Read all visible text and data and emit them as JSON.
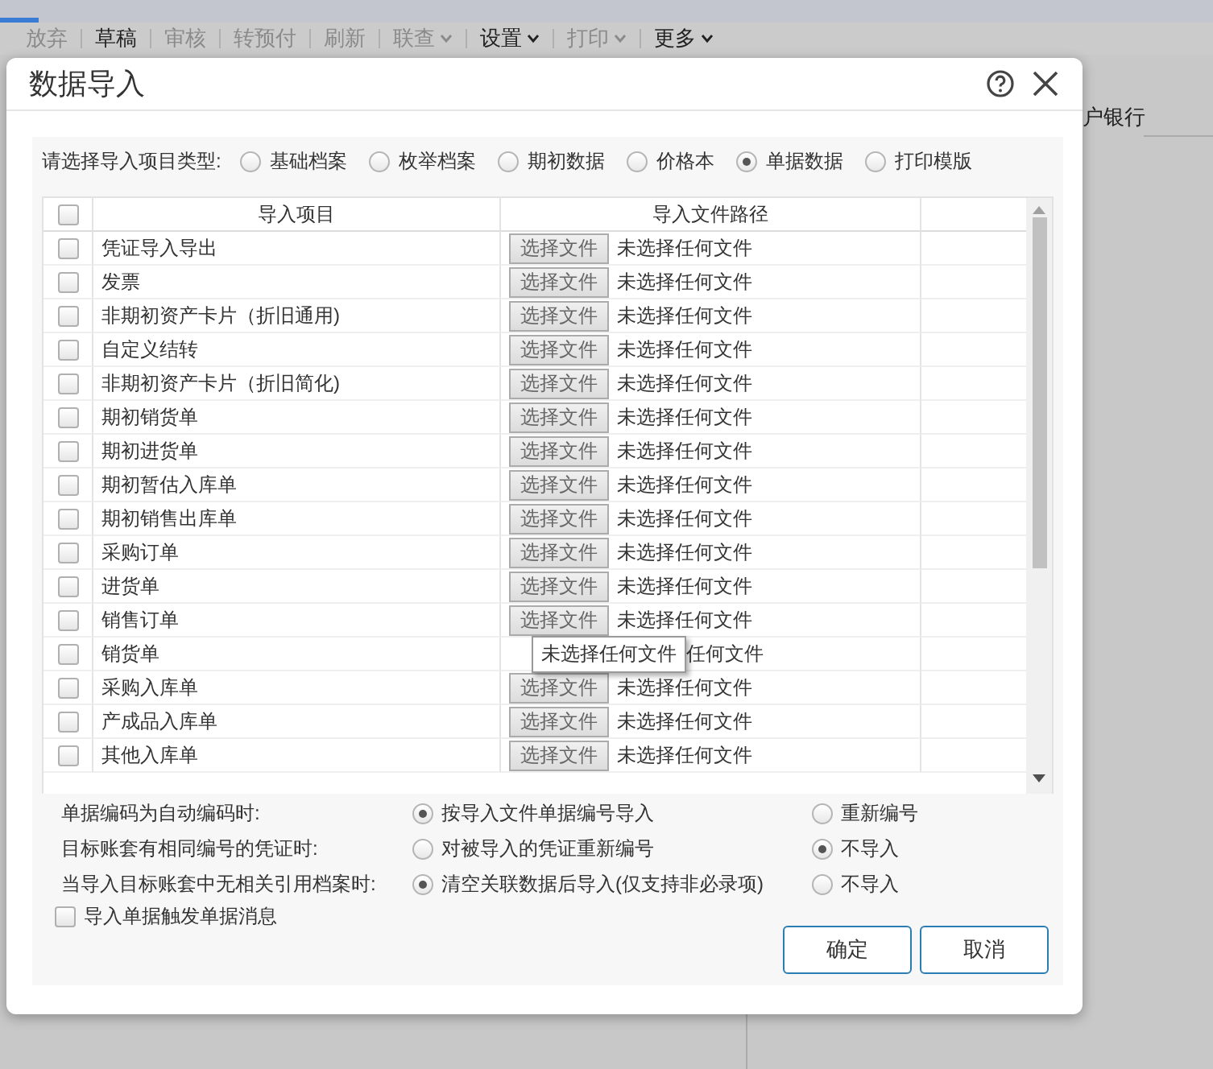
{
  "background": {
    "toolbar": [
      {
        "label": "放弃",
        "caret": false,
        "disabled": true
      },
      {
        "label": "草稿",
        "caret": false,
        "disabled": false
      },
      {
        "label": "审核",
        "caret": false,
        "disabled": true
      },
      {
        "label": "转预付",
        "caret": false,
        "disabled": true
      },
      {
        "label": "刷新",
        "caret": false,
        "disabled": true
      },
      {
        "label": "联查",
        "caret": true,
        "disabled": true
      },
      {
        "label": "设置",
        "caret": true,
        "disabled": false
      },
      {
        "label": "打印",
        "caret": true,
        "disabled": true
      },
      {
        "label": "更多",
        "caret": true,
        "disabled": false
      }
    ],
    "field_label": "户银行"
  },
  "dialog": {
    "title": "数据导入",
    "type_prompt": "请选择导入项目类型:",
    "types": [
      {
        "label": "基础档案",
        "selected": false
      },
      {
        "label": "枚举档案",
        "selected": false
      },
      {
        "label": "期初数据",
        "selected": false
      },
      {
        "label": "价格本",
        "selected": false
      },
      {
        "label": "单据数据",
        "selected": true
      },
      {
        "label": "打印模版",
        "selected": false
      }
    ],
    "table": {
      "columns": [
        "导入项目",
        "导入文件路径"
      ],
      "header_checked": false,
      "rows": [
        {
          "name": "凭证导入导出",
          "checked": false,
          "button": "选择文件",
          "status": "未选择任何文件"
        },
        {
          "name": "发票",
          "checked": false,
          "button": "选择文件",
          "status": "未选择任何文件"
        },
        {
          "name": "非期初资产卡片（折旧通用)",
          "checked": false,
          "button": "选择文件",
          "status": "未选择任何文件"
        },
        {
          "name": "自定义结转",
          "checked": false,
          "button": "选择文件",
          "status": "未选择任何文件"
        },
        {
          "name": "非期初资产卡片（折旧简化)",
          "checked": false,
          "button": "选择文件",
          "status": "未选择任何文件"
        },
        {
          "name": "期初销货单",
          "checked": false,
          "button": "选择文件",
          "status": "未选择任何文件"
        },
        {
          "name": "期初进货单",
          "checked": false,
          "button": "选择文件",
          "status": "未选择任何文件"
        },
        {
          "name": "期初暂估入库单",
          "checked": false,
          "button": "选择文件",
          "status": "未选择任何文件"
        },
        {
          "name": "期初销售出库单",
          "checked": false,
          "button": "选择文件",
          "status": "未选择任何文件"
        },
        {
          "name": "采购订单",
          "checked": false,
          "button": "选择文件",
          "status": "未选择任何文件"
        },
        {
          "name": "进货单",
          "checked": false,
          "button": "选择文件",
          "status": "未选择任何文件"
        },
        {
          "name": "销售订单",
          "checked": false,
          "button": "选择文件",
          "status": "未选择任何文件"
        },
        {
          "name": "销货单",
          "checked": false,
          "tooltip": "未选择任何文件",
          "status": "任何文件"
        },
        {
          "name": "采购入库单",
          "checked": false,
          "button": "选择文件",
          "status": "未选择任何文件"
        },
        {
          "name": "产成品入库单",
          "checked": false,
          "button": "选择文件",
          "status": "未选择任何文件"
        },
        {
          "name": "其他入库单",
          "checked": false,
          "button": "选择文件",
          "status": "未选择任何文件"
        }
      ]
    },
    "options": [
      {
        "label": "单据编码为自动编码时:",
        "choices": [
          {
            "label": "按导入文件单据编号导入",
            "selected": true
          },
          {
            "label": "重新编号",
            "selected": false
          }
        ]
      },
      {
        "label": "目标账套有相同编号的凭证时:",
        "choices": [
          {
            "label": "对被导入的凭证重新编号",
            "selected": false
          },
          {
            "label": "不导入",
            "selected": true
          }
        ]
      },
      {
        "label": "当导入目标账套中无相关引用档案时:",
        "choices": [
          {
            "label": "清空关联数据后导入(仅支持非必录项)",
            "selected": true
          },
          {
            "label": "不导入",
            "selected": false
          }
        ]
      }
    ],
    "trigger": {
      "label": "导入单据触发单据消息",
      "checked": false
    },
    "buttons": [
      "确定",
      "取消"
    ]
  }
}
